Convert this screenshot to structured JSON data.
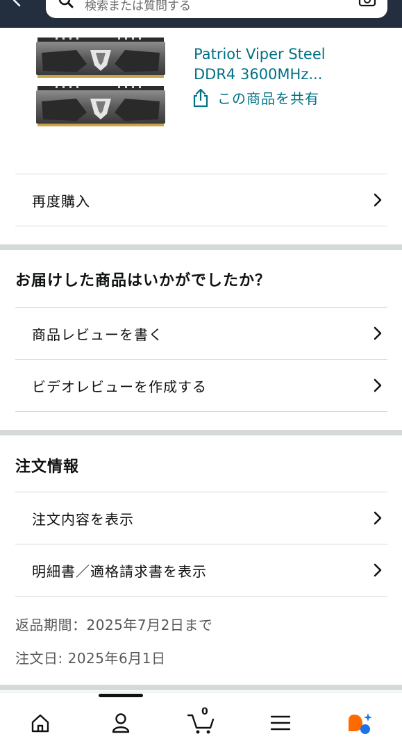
{
  "search": {
    "placeholder": "検索または質問する"
  },
  "product": {
    "title_line1": "Patriot Viper Steel",
    "title_line2": "DDR4 3600MHz...",
    "share_label": "この商品を共有"
  },
  "buy_again": {
    "label": "再度購入"
  },
  "feedback": {
    "title": "お届けした商品はいかがでしたか？",
    "items": [
      {
        "label": "商品レビューを書く"
      },
      {
        "label": "ビデオレビューを作成する"
      }
    ]
  },
  "order_info": {
    "title": "注文情報",
    "items": [
      {
        "label": "注文内容を表示"
      },
      {
        "label": "明細書／適格請求書を表示"
      }
    ],
    "return_period": "返品期間：2025年7月2日まで",
    "order_date": "注文日: 2025年6月1日"
  },
  "bottom_nav": {
    "items": [
      {
        "icon": "home-icon"
      },
      {
        "icon": "account-icon"
      },
      {
        "icon": "cart-icon",
        "count": "0"
      },
      {
        "icon": "menu-icon"
      },
      {
        "icon": "rufus-assistant-icon"
      }
    ],
    "active_index": 1
  },
  "colors": {
    "header_bg": "#232f3e",
    "link": "#007185",
    "separator": "#d5d9d9",
    "text": "#0f1111",
    "secondary_text": "#565959",
    "assistant_orange": "#ff6a00",
    "assistant_blue": "#1a73e8"
  }
}
